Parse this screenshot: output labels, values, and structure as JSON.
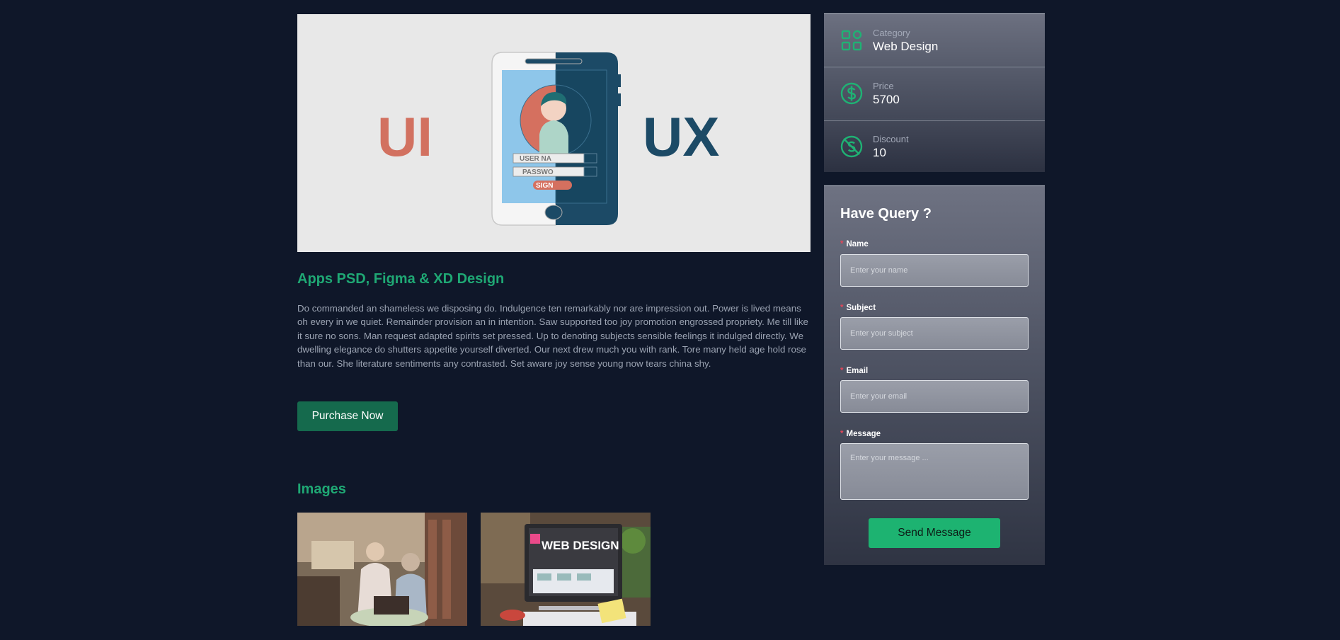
{
  "hero": {
    "left_text": "UI",
    "right_text": "UX",
    "phone_user_field": "USER NA",
    "phone_pass_field": "PASSWO",
    "phone_sign_button": "SIGN"
  },
  "product": {
    "title": "Apps PSD, Figma & XD Design",
    "description": "Do commanded an shameless we disposing do. Indulgence ten remarkably nor are impression out. Power is lived means oh every in we quiet. Remainder provision an in intention. Saw supported too joy promotion engrossed propriety. Me till like it sure no sons. Man request adapted spirits set pressed. Up to denoting subjects sensible feelings it indulged directly. We dwelling elegance do shutters appetite yourself diverted. Our next drew much you with rank. Tore many held age hold rose than our. She literature sentiments any contrasted. Set aware joy sense young now tears china shy.",
    "purchase_label": "Purchase Now"
  },
  "images": {
    "heading": "Images",
    "thumb2_text": "WEB DESIGN"
  },
  "sidebar": {
    "info": [
      {
        "label": "Category",
        "value": "Web Design",
        "icon": "category-grid-icon"
      },
      {
        "label": "Price",
        "value": "5700",
        "icon": "dollar-circle-icon"
      },
      {
        "label": "Discount",
        "value": "10",
        "icon": "discount-off-icon"
      }
    ],
    "query": {
      "title": "Have Query ?",
      "required_mark": "*",
      "fields": [
        {
          "label": "Name",
          "placeholder": "Enter your name"
        },
        {
          "label": "Subject",
          "placeholder": "Enter your subject"
        },
        {
          "label": "Email",
          "placeholder": "Enter your email"
        },
        {
          "label": "Message",
          "placeholder": "Enter your message ..."
        }
      ],
      "send_label": "Send Message"
    }
  },
  "colors": {
    "background": "#0f1729",
    "accent_green": "#1fa874",
    "button_dark_green": "#156a4d",
    "button_bright_green": "#1db371",
    "required_red": "#e0475a"
  }
}
